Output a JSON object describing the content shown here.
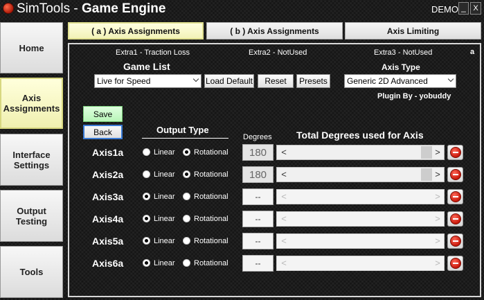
{
  "app": {
    "name": "SimTools",
    "separator": " - ",
    "subtitle": "Game Engine",
    "mode": "DEMO",
    "minimize": "_",
    "close": "X"
  },
  "sidebar": {
    "items": [
      {
        "label": "Home"
      },
      {
        "label": "Axis Assignments"
      },
      {
        "label": "Interface Settings"
      },
      {
        "label": "Output Testing"
      },
      {
        "label": "Tools"
      }
    ],
    "active": "Axis Assignments"
  },
  "tabs": [
    {
      "label": "( a ) Axis Assignments"
    },
    {
      "label": "( b ) Axis Assignments"
    },
    {
      "label": "Axis Limiting"
    }
  ],
  "extras": [
    "Extra1 - Traction Loss",
    "Extra2 - NotUsed",
    "Extra3 - NotUsed"
  ],
  "corner_label": "a",
  "game_list": {
    "label": "Game List",
    "selected": "Live for Speed"
  },
  "buttons": {
    "load_default": "Load Default",
    "reset": "Reset",
    "presets": "Presets",
    "save": "Save",
    "back": "Back"
  },
  "axis_type": {
    "label": "Axis Type",
    "selected": "Generic 2D Advanced"
  },
  "plugin_by": "Plugin By - yobuddy",
  "headers": {
    "output_type": "Output Type",
    "degrees": "Degrees",
    "total_degrees": "Total Degrees used for Axis"
  },
  "radio_labels": {
    "linear": "Linear",
    "rotational": "Rotational"
  },
  "scroll_arrows": {
    "left": "<",
    "right": ">"
  },
  "axes": [
    {
      "name": "Axis1a",
      "output": "linear",
      "degrees": "180",
      "enabled": true
    },
    {
      "name": "Axis2a",
      "output": "linear",
      "degrees": "180",
      "enabled": true
    },
    {
      "name": "Axis3a",
      "output": "rotational",
      "degrees": "--",
      "enabled": false
    },
    {
      "name": "Axis4a",
      "output": "rotational",
      "degrees": "--",
      "enabled": false
    },
    {
      "name": "Axis5a",
      "output": "rotational",
      "degrees": "--",
      "enabled": false
    },
    {
      "name": "Axis6a",
      "output": "rotational",
      "degrees": "--",
      "enabled": false
    }
  ],
  "colors": {
    "accent_red": "#c8180a",
    "active_tab": "#f2f2b8",
    "save_green": "#b8f5b8",
    "focus_blue": "#3a7bd5"
  }
}
